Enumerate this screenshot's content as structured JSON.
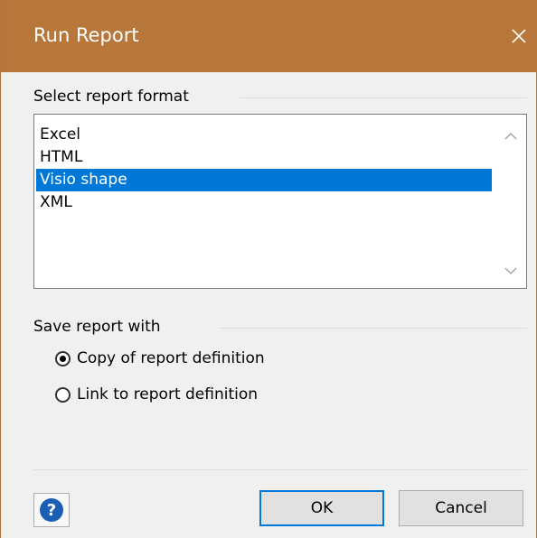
{
  "window": {
    "title": "Run Report",
    "close_icon": "close-icon"
  },
  "format_group": {
    "label": "Select report format",
    "items": [
      {
        "label": "Excel",
        "selected": false
      },
      {
        "label": "HTML",
        "selected": false
      },
      {
        "label": "Visio shape",
        "selected": true
      },
      {
        "label": "XML",
        "selected": false
      }
    ],
    "scroll_up_icon": "chevron-up-icon",
    "scroll_down_icon": "chevron-down-icon"
  },
  "save_group": {
    "label": "Save report with",
    "options": [
      {
        "label": "Copy of report definition",
        "checked": true
      },
      {
        "label": "Link to report definition",
        "checked": false
      }
    ]
  },
  "footer": {
    "help_icon": "help-icon",
    "help_glyph": "?",
    "ok_label": "OK",
    "cancel_label": "Cancel"
  },
  "colors": {
    "titlebar": "#b8773a",
    "selection": "#0078d7",
    "help_blue": "#1a5fb4"
  }
}
